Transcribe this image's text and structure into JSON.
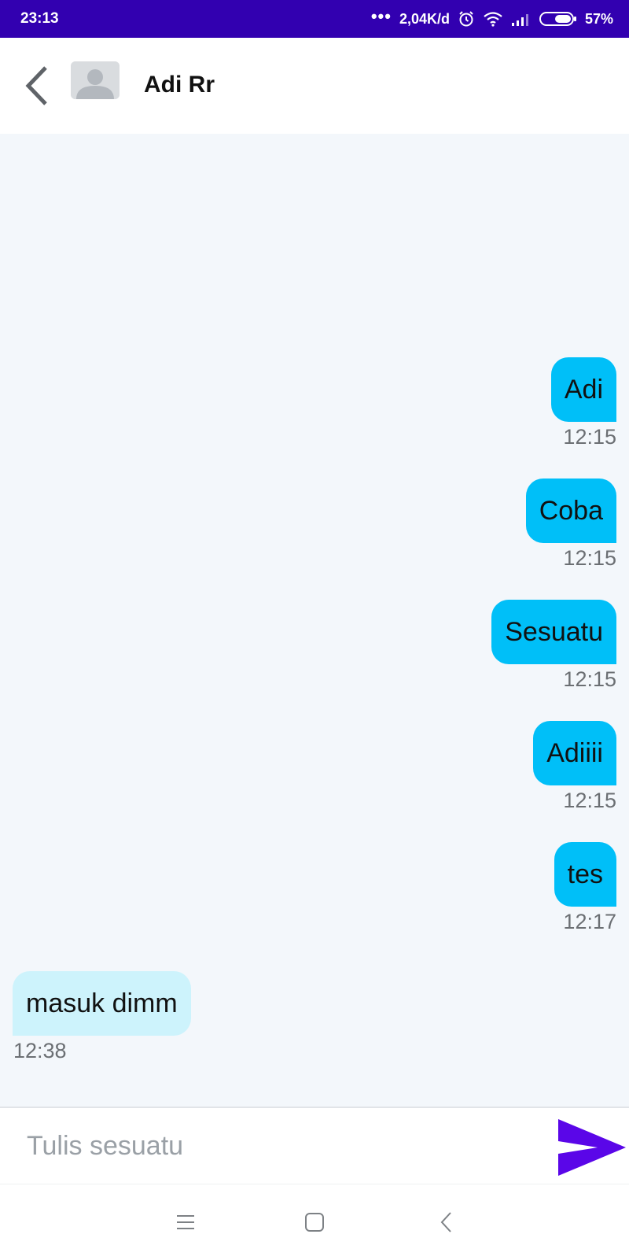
{
  "status_bar": {
    "time": "23:13",
    "more": "•••",
    "speed": "2,04K/d",
    "battery": "57%",
    "icons": [
      "alarm-icon",
      "wifi-icon",
      "signal-icon",
      "battery-icon"
    ]
  },
  "header": {
    "contact_name": "Adi Rr",
    "back_icon": "chevron-left-icon",
    "avatar_icon": "default-avatar-icon"
  },
  "messages": [
    {
      "direction": "outgoing",
      "text": "Adi",
      "time": "12:15"
    },
    {
      "direction": "outgoing",
      "text": "Coba",
      "time": "12:15"
    },
    {
      "direction": "outgoing",
      "text": "Sesuatu",
      "time": "12:15"
    },
    {
      "direction": "outgoing",
      "text": "Adiiii",
      "time": "12:15"
    },
    {
      "direction": "outgoing",
      "text": "tes",
      "time": "12:17"
    },
    {
      "direction": "incoming",
      "text": "masuk dimm",
      "time": "12:38"
    }
  ],
  "composer": {
    "value": "",
    "placeholder": "Tulis sesuatu",
    "send_icon": "send-icon"
  },
  "nav_bar": {
    "icons": [
      "menu-icon",
      "home-icon",
      "back-icon"
    ]
  },
  "colors": {
    "status_bar": "#3200b0",
    "outgoing_bubble": "#00bff8",
    "incoming_bubble": "#cdf3fc",
    "chat_background": "#f3f7fb",
    "send_accent": "#5a06e8"
  }
}
